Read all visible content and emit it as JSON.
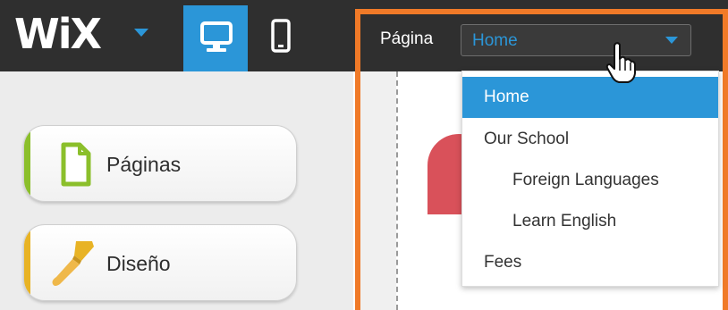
{
  "toolbar": {
    "logo_text": "WiX",
    "desktop_icon": "desktop-monitor-icon",
    "mobile_icon": "mobile-phone-icon",
    "page_label": "Página",
    "page_select_value": "Home",
    "colors": {
      "bar": "#2f2f2f",
      "accent": "#2b96d8"
    }
  },
  "sidebar": {
    "items": [
      {
        "label": "Páginas",
        "icon": "page-document-icon",
        "accent": "#8bbf2b"
      },
      {
        "label": "Diseño",
        "icon": "paintbrush-icon",
        "accent": "#e8b325"
      }
    ]
  },
  "page_menu": {
    "items": [
      {
        "label": "Home",
        "selected": true,
        "indent": 0
      },
      {
        "label": "Our School",
        "selected": false,
        "indent": 0
      },
      {
        "label": "Foreign Languages",
        "selected": false,
        "indent": 1
      },
      {
        "label": "Learn English",
        "selected": false,
        "indent": 1
      },
      {
        "label": "Fees",
        "selected": false,
        "indent": 0
      }
    ]
  },
  "editor": {
    "frame_color": "#f07a28"
  }
}
